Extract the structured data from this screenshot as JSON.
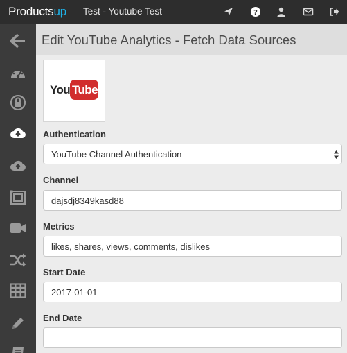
{
  "app": {
    "brand_main": "Products",
    "brand_accent": "up",
    "tab_title": "Test - Youtube Test"
  },
  "top_icons": [
    "navigate-icon",
    "help-icon",
    "user-icon",
    "mail-icon",
    "logout-icon"
  ],
  "sidebar": {
    "items": [
      "back-arrow-icon",
      "dashboard-icon",
      "lock-icon",
      "cloud-download-icon",
      "cloud-upload-icon",
      "layers-icon",
      "video-camera-icon",
      "shuffle-icon",
      "table-icon",
      "pencil-icon",
      "book-icon"
    ]
  },
  "page": {
    "title": "Edit YouTube Analytics - Fetch Data Sources",
    "logo": {
      "you": "You",
      "tube": "Tube"
    }
  },
  "form": {
    "authentication": {
      "label": "Authentication",
      "value": "YouTube Channel Authentication"
    },
    "channel": {
      "label": "Channel",
      "value": "dajsdj8349kasd88"
    },
    "metrics": {
      "label": "Metrics",
      "value": "likes, shares, views, comments, dislikes"
    },
    "start_date": {
      "label": "Start Date",
      "value": "2017-01-01"
    },
    "end_date": {
      "label": "End Date",
      "value": ""
    }
  },
  "colors": {
    "topbar": "#2d2d2d",
    "sidebar": "#3b3b3b",
    "brand_accent": "#1eb2e8",
    "youtube_red": "#d12c2c"
  }
}
